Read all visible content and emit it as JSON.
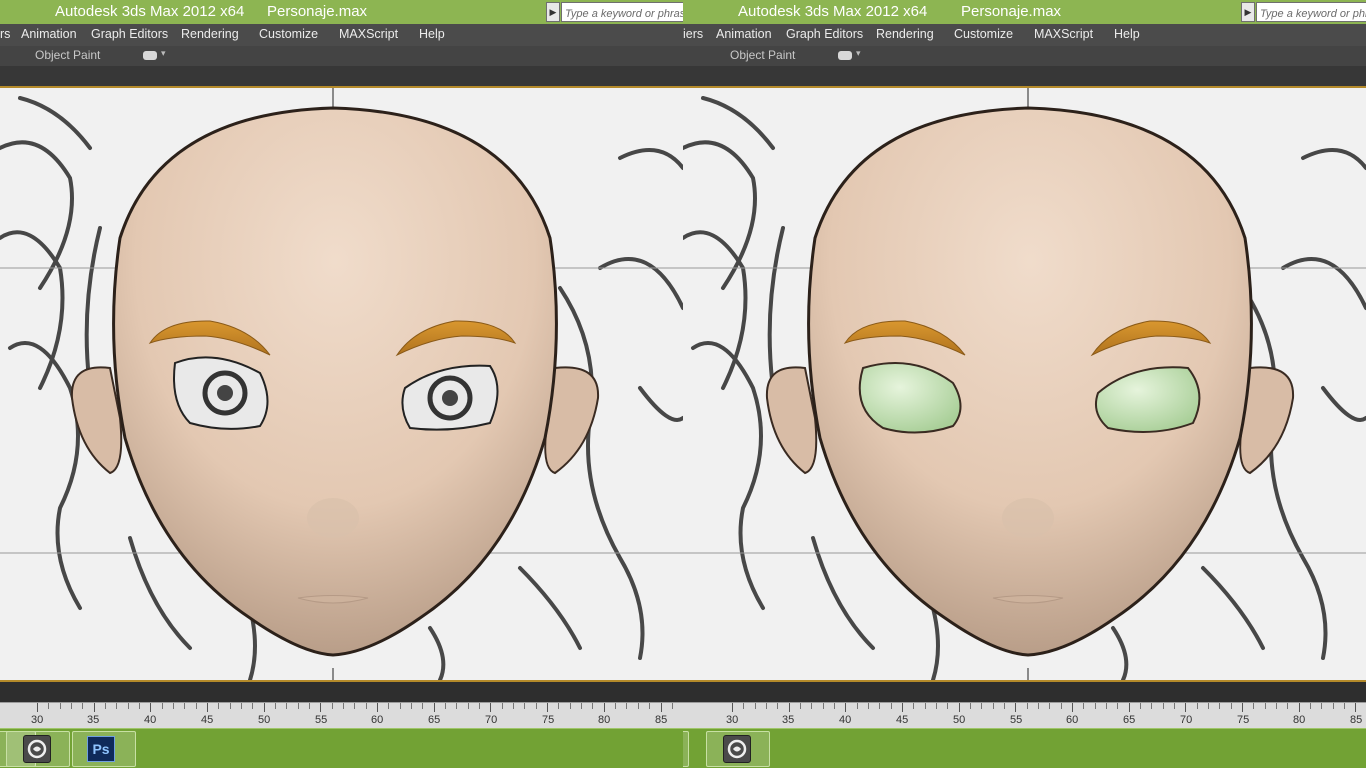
{
  "window": {
    "app_title": "Autodesk 3ds Max  2012 x64",
    "file_title": "Personaje.max",
    "search_placeholder": "Type a keyword or phrase"
  },
  "menu": {
    "left_items": [
      "rs",
      "Animation",
      "Graph Editors",
      "Rendering",
      "Customize",
      "MAXScript",
      "Help"
    ],
    "right_items": [
      "iers",
      "Animation",
      "Graph Editors",
      "Rendering",
      "Customize",
      "MAXScript",
      "Help"
    ]
  },
  "ribbon": {
    "object_paint_label": "Object Paint"
  },
  "timeline": {
    "ticks": [
      "30",
      "35",
      "40",
      "45",
      "50",
      "55",
      "60",
      "65",
      "70",
      "75",
      "80",
      "85"
    ]
  },
  "taskbar": {
    "left_apps": [
      {
        "name": "3ds Max",
        "icon": "3dsmax-icon"
      },
      {
        "name": "Photoshop",
        "icon": "photoshop-icon",
        "label": "Ps"
      }
    ],
    "right_apps": [
      {
        "name": "3ds Max",
        "icon": "3dsmax-icon"
      }
    ]
  },
  "viewport": {
    "left_eyes": "sketch-reference",
    "right_eyes": "green-eyeball-mesh",
    "colors": {
      "skin": "#e6cdb8",
      "eyebrow": "#c98a2e",
      "eye_mesh": "#c9e4bb",
      "background": "#f1f1f1",
      "titlebar": "#8db552",
      "taskbar": "#72a234"
    }
  }
}
